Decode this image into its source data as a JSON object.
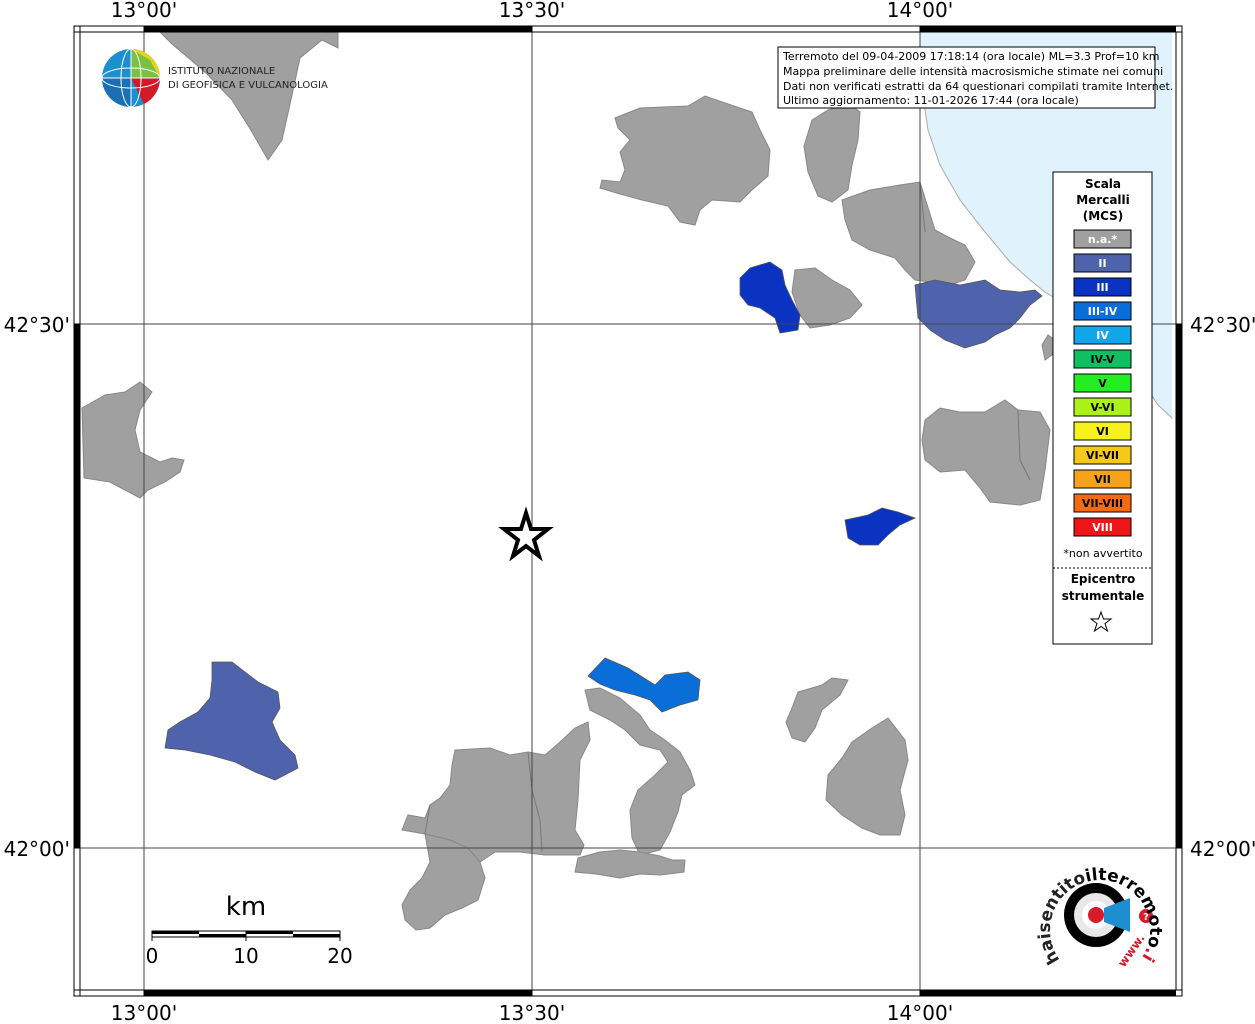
{
  "map": {
    "lon_labels": [
      "13°00'",
      "13°30'",
      "14°00'"
    ],
    "lat_labels": [
      "42°30'",
      "42°00'"
    ]
  },
  "info": {
    "line1": "Terremoto del 09-04-2009 17:18:14 (ora locale) ML=3.3 Prof=10 km",
    "line2": "Mappa preliminare delle intensità macrosismiche stimate nei comuni",
    "line3": "Dati non verificati estratti da 64 questionari compilati tramite Internet.",
    "line4": "Ultimo aggiornamento: 11-01-2026 17:44 (ora locale)"
  },
  "logo": {
    "line1": "ISTITUTO NAZIONALE",
    "line2": "DI GEOFISICA E VULCANOLOGIA",
    "site_prefix": "haisentito",
    "site_main": "ilterremoto",
    "site_suffix": ".it",
    "site_www": "www."
  },
  "legend": {
    "title1": "Scala",
    "title2": "Mercalli",
    "title3": "(MCS)",
    "items": [
      {
        "label": "n.a.*",
        "color": "#a0a0a0",
        "text_color": "#ffffff"
      },
      {
        "label": "II",
        "color": "#4f63ad",
        "text_color": "#ffffff"
      },
      {
        "label": "III",
        "color": "#0a33c2",
        "text_color": "#ffffff"
      },
      {
        "label": "III-IV",
        "color": "#0a6ed8",
        "text_color": "#ffffff"
      },
      {
        "label": "IV",
        "color": "#12a6ea",
        "text_color": "#ffffff"
      },
      {
        "label": "IV-V",
        "color": "#10c060",
        "text_color": "#000000"
      },
      {
        "label": "V",
        "color": "#22ee22",
        "text_color": "#000000"
      },
      {
        "label": "V-VI",
        "color": "#aaf21a",
        "text_color": "#000000"
      },
      {
        "label": "VI",
        "color": "#f6f21a",
        "text_color": "#000000"
      },
      {
        "label": "VI-VII",
        "color": "#f6c81a",
        "text_color": "#000000"
      },
      {
        "label": "VII",
        "color": "#f6a31a",
        "text_color": "#000000"
      },
      {
        "label": "VII-VIII",
        "color": "#f26b14",
        "text_color": "#000000"
      },
      {
        "label": "VIII",
        "color": "#ee1616",
        "text_color": "#ffffff"
      }
    ],
    "note": "*non avvertito",
    "epicentre1": "Epicentro",
    "epicentre2": "strumentale"
  },
  "scale_bar": {
    "unit": "km",
    "ticks": [
      "0",
      "10",
      "20"
    ]
  },
  "colors": {
    "not_felt": "#a0a0a0",
    "sea": "#e0f2fc"
  }
}
